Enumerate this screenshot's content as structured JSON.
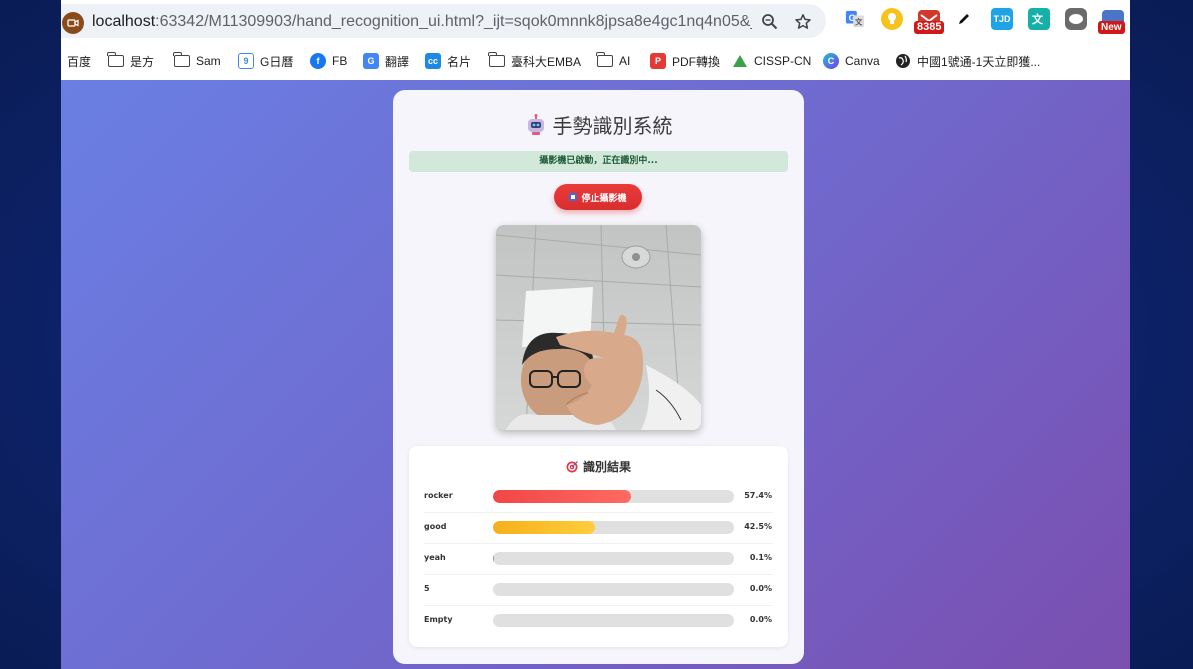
{
  "browser": {
    "url_main": "localhost",
    "url_rest": ":63342/M11309903/hand_recognition_ui.html?_ijt=sqok0mnnk8jpsa8e4gc1nq4n05&_i...",
    "mail_badge": "8385",
    "new_badge": "New",
    "tjd_label": "TJD"
  },
  "bookmarks": [
    {
      "label": "百度",
      "icon": "none"
    },
    {
      "label": "是方",
      "icon": "folder-icon"
    },
    {
      "label": "Sam",
      "icon": "folder-icon"
    },
    {
      "label": "G日曆",
      "icon": "calendar-icon"
    },
    {
      "label": "FB",
      "icon": "facebook-icon"
    },
    {
      "label": "翻譯",
      "icon": "translate-icon"
    },
    {
      "label": "名片",
      "icon": "cc-icon"
    },
    {
      "label": "臺科大EMBA",
      "icon": "folder-icon"
    },
    {
      "label": "AI",
      "icon": "folder-icon"
    },
    {
      "label": "PDF轉換",
      "icon": "pdf-icon"
    },
    {
      "label": "CISSP-CN",
      "icon": "triangle-icon"
    },
    {
      "label": "Canva",
      "icon": "canva-icon"
    },
    {
      "label": "中國1號通-1天立即獲...",
      "icon": "globe-icon"
    }
  ],
  "app": {
    "title": "手勢識別系統",
    "status": "攝影機已啟動，正在識別中...",
    "stop_button": "停止攝影機",
    "results_title": "識別結果"
  },
  "results": [
    {
      "label": "rocker",
      "percent_text": "57.4%",
      "value": 57.4,
      "color": "red"
    },
    {
      "label": "good",
      "percent_text": "42.5%",
      "value": 42.5,
      "color": "orange"
    },
    {
      "label": "yeah",
      "percent_text": "0.1%",
      "value": 0.1,
      "color": "gray"
    },
    {
      "label": "5",
      "percent_text": "0.0%",
      "value": 0.0,
      "color": "gray"
    },
    {
      "label": "Empty",
      "percent_text": "0.0%",
      "value": 0.0,
      "color": "gray"
    }
  ],
  "colors": {
    "red_gradient": [
      "#f04646",
      "#ff6b61"
    ],
    "orange_gradient": [
      "#f5b01a",
      "#ffcd3c"
    ],
    "gray": "#999999"
  }
}
